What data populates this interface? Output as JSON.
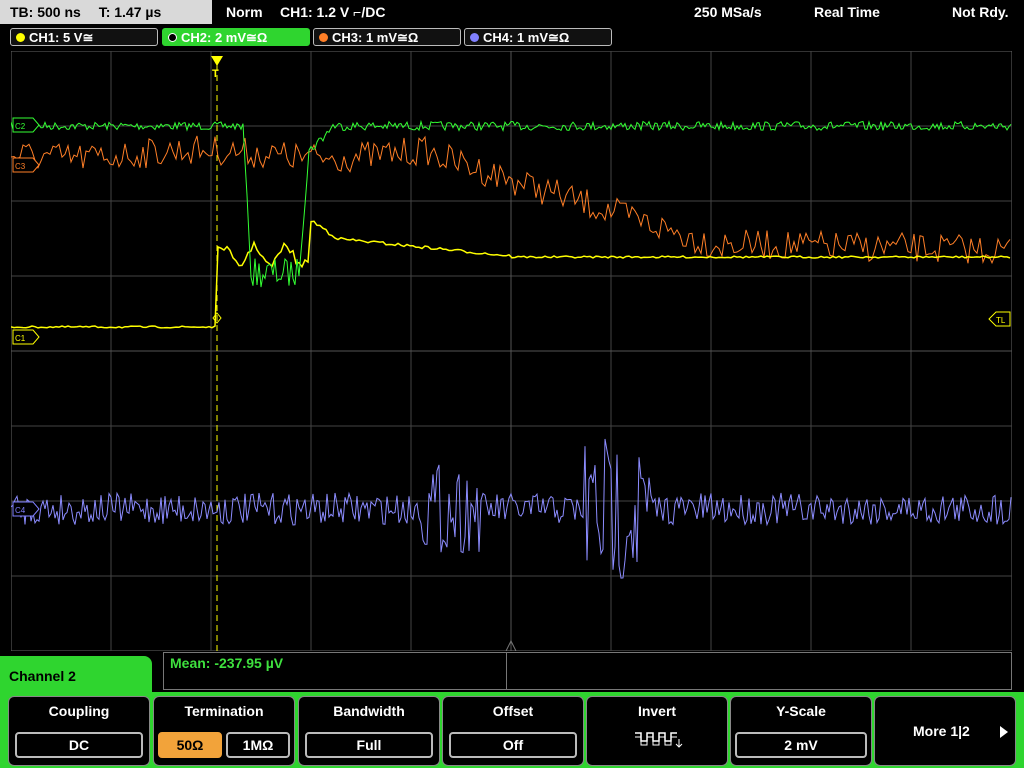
{
  "status_bar": {
    "timebase": "TB: 500 ns",
    "trigger_time": "T: 1.47 µs",
    "mode": "Norm",
    "trigger": "CH1: 1.2 V ⌐/DC",
    "sample_rate": "250 MSa/s",
    "acq_mode": "Real Time",
    "ready_state": "Not Rdy."
  },
  "channels": [
    {
      "label": "CH1: 5 V≅",
      "color": "#ffff00"
    },
    {
      "label": "CH2: 2 mV≅Ω",
      "color": "#2fd52f"
    },
    {
      "label": "CH3: 1 mV≅Ω",
      "color": "#ff7f27"
    },
    {
      "label": "CH4: 1 mV≅Ω",
      "color": "#8080ff"
    }
  ],
  "markers": {
    "c1": "C1",
    "c2": "C2",
    "c3": "C3",
    "c4": "C4",
    "trigger_level": "TL"
  },
  "measurement": "Mean: -237.95 µV",
  "menu": {
    "channel_label": "Channel 2",
    "coupling": {
      "title": "Coupling",
      "value": "DC"
    },
    "termination": {
      "title": "Termination",
      "opt1": "50Ω",
      "opt2": "1MΩ"
    },
    "bandwidth": {
      "title": "Bandwidth",
      "value": "Full"
    },
    "offset": {
      "title": "Offset",
      "value": "Off"
    },
    "invert": {
      "title": "Invert"
    },
    "yscale": {
      "title": "Y-Scale",
      "value": "2 mV"
    },
    "more": "More 1|2"
  }
}
